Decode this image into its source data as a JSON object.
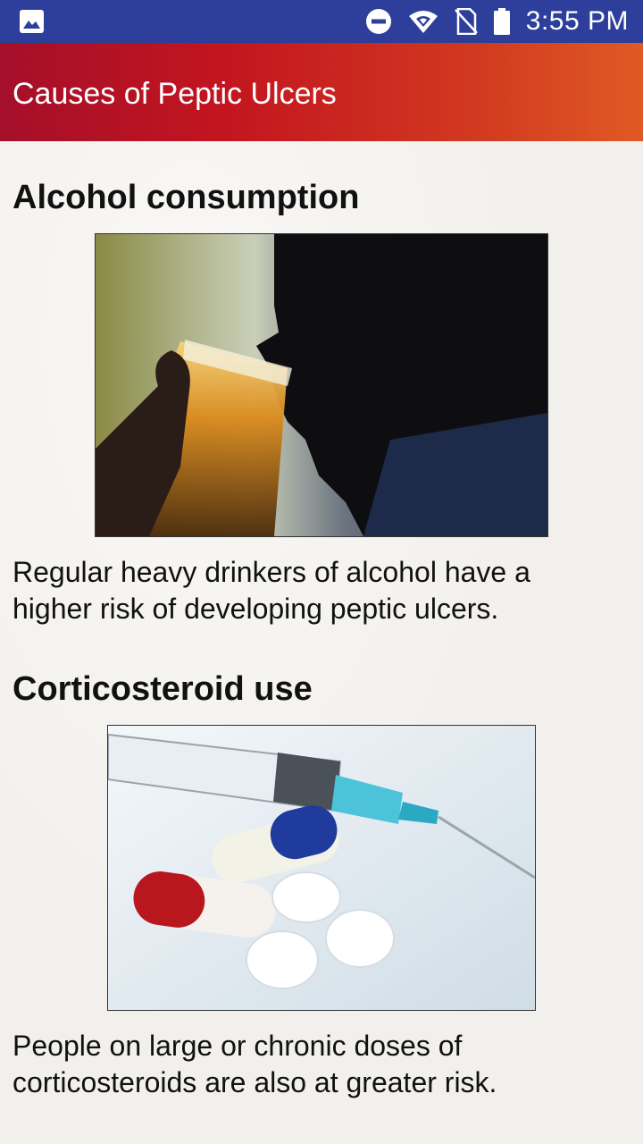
{
  "status_bar": {
    "time": "3:55 PM",
    "icons": [
      "image-icon",
      "do-not-disturb-icon",
      "wifi-icon",
      "no-sim-icon",
      "battery-icon"
    ]
  },
  "app_bar": {
    "title": "Causes of Peptic Ulcers"
  },
  "sections": [
    {
      "heading": "Alcohol consumption",
      "image": "man drinking beer photo",
      "text_lines": [
        "Regular heavy drinkers of alcohol have a",
        "higher risk of developing peptic ulcers."
      ]
    },
    {
      "heading": "Corticosteroid use",
      "image": "syringe and pills photo",
      "text_lines": [
        "People on large or chronic doses of",
        "corticosteroids are also at greater risk."
      ]
    }
  ],
  "colors": {
    "status_bar": "#2d3f9a",
    "app_bar_start": "#a50f2a",
    "app_bar_end": "#e05a24"
  }
}
